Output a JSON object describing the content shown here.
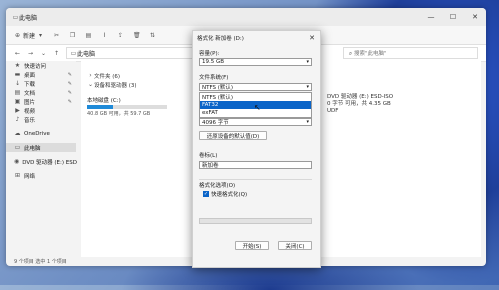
{
  "explorer": {
    "title": "此电脑",
    "new_label": "新建",
    "address": "此电脑",
    "search_placeholder": "搜索\"此电脑\"",
    "sidebar": [
      {
        "label": "快速访问",
        "pinned": false
      },
      {
        "label": "桌面",
        "pinned": true
      },
      {
        "label": "下载",
        "pinned": true
      },
      {
        "label": "文档",
        "pinned": true
      },
      {
        "label": "图片",
        "pinned": true
      },
      {
        "label": "视频",
        "pinned": false
      },
      {
        "label": "音乐",
        "pinned": false
      },
      {
        "label": "OneDrive",
        "pinned": false
      },
      {
        "label": "此电脑",
        "pinned": false
      },
      {
        "label": "DVD 驱动器 (E:) ESD",
        "pinned": false
      },
      {
        "label": "网络",
        "pinned": false
      }
    ],
    "groups": {
      "folders": "文件夹 (6)",
      "devices": "设备和驱动器 (3)"
    },
    "drive_c": {
      "name": "本地磁盘 (C:)",
      "info": "40.8 GB 可用，共 59.7 GB",
      "used_fraction": 0.32
    },
    "dvd": {
      "name": "DVD 驱动器 (E:) ESD-ISO",
      "info": "0 字节 可用，共 4.35 GB",
      "fs": "UDF"
    },
    "status": "9 个项目    选中 1 个项目"
  },
  "dialog": {
    "title": "格式化 新加卷 (D:)",
    "capacity_label": "容量(P):",
    "capacity_value": "19.5 GB",
    "fs_label": "文件系统(F)",
    "fs_value": "NTFS (默认)",
    "fs_options": [
      "NTFS (默认)",
      "FAT32",
      "exFAT"
    ],
    "fs_highlight_index": 1,
    "alloc_value": "4096 字节",
    "restore_label": "还原设备的默认值(D)",
    "volume_label": "卷标(L)",
    "volume_value": "新加卷",
    "format_options_label": "格式化选项(O)",
    "quick_format_label": "快速格式化(Q)",
    "start_label": "开始(S)",
    "close_label": "关闭(C)"
  }
}
